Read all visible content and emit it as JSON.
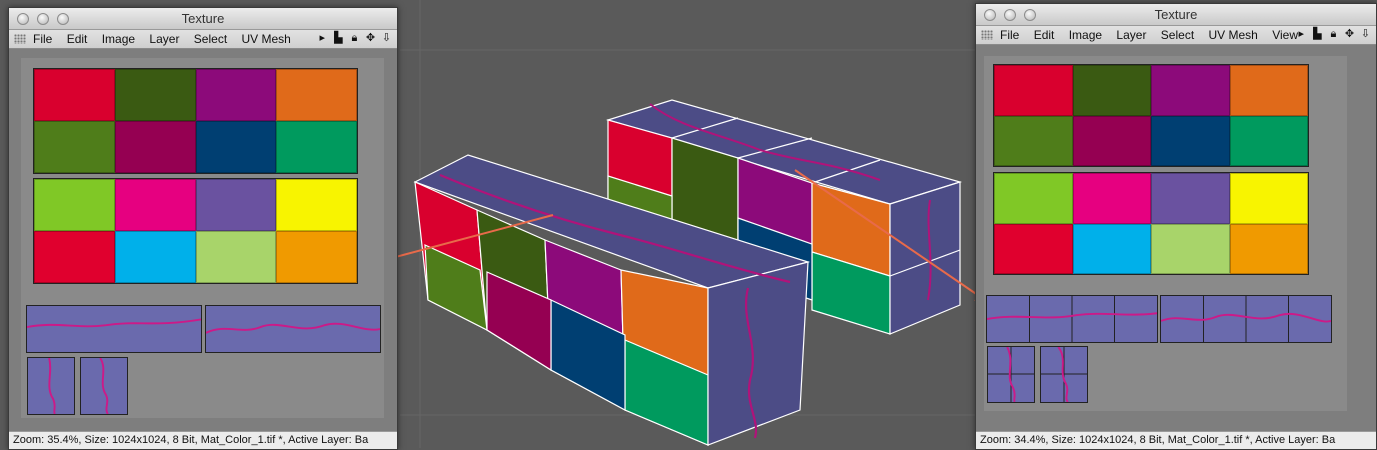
{
  "palette": [
    "#d9002e",
    "#3a5a12",
    "#8c0a7a",
    "#e06a1a",
    "#4f7d1a",
    "#950052",
    "#003f72",
    "#009a5e",
    "#80c826",
    "#e60080",
    "#6a52a0",
    "#f8f400",
    "#e0002e",
    "#00b0ea",
    "#a8d46a",
    "#f09a00"
  ],
  "uvColor": "#6a6aad",
  "seamColor": "#cc1a88",
  "arrowColor": "#e86a4a",
  "windows": [
    {
      "title": "Texture",
      "menus": [
        "File",
        "Edit",
        "Image",
        "Layer",
        "Select",
        "UV Mesh"
      ],
      "tool_icons": [
        "▸",
        "histogram-icon",
        "lock-icon",
        "move-icon",
        "down-arrow-icon"
      ],
      "status": "Zoom: 35.4%, Size: 1024x1024, 8 Bit, Mat_Color_1.tif *, Active Layer: Ba"
    },
    {
      "title": "Texture",
      "menus": [
        "File",
        "Edit",
        "Image",
        "Layer",
        "Select",
        "UV Mesh",
        "View"
      ],
      "tool_icons": [
        "▸",
        "histogram-icon",
        "lock-icon",
        "move-icon",
        "down-arrow-icon"
      ],
      "status": "Zoom: 34.4%, Size: 1024x1024, 8 Bit, Mat_Color_1.tif *, Active Layer: Ba"
    }
  ]
}
